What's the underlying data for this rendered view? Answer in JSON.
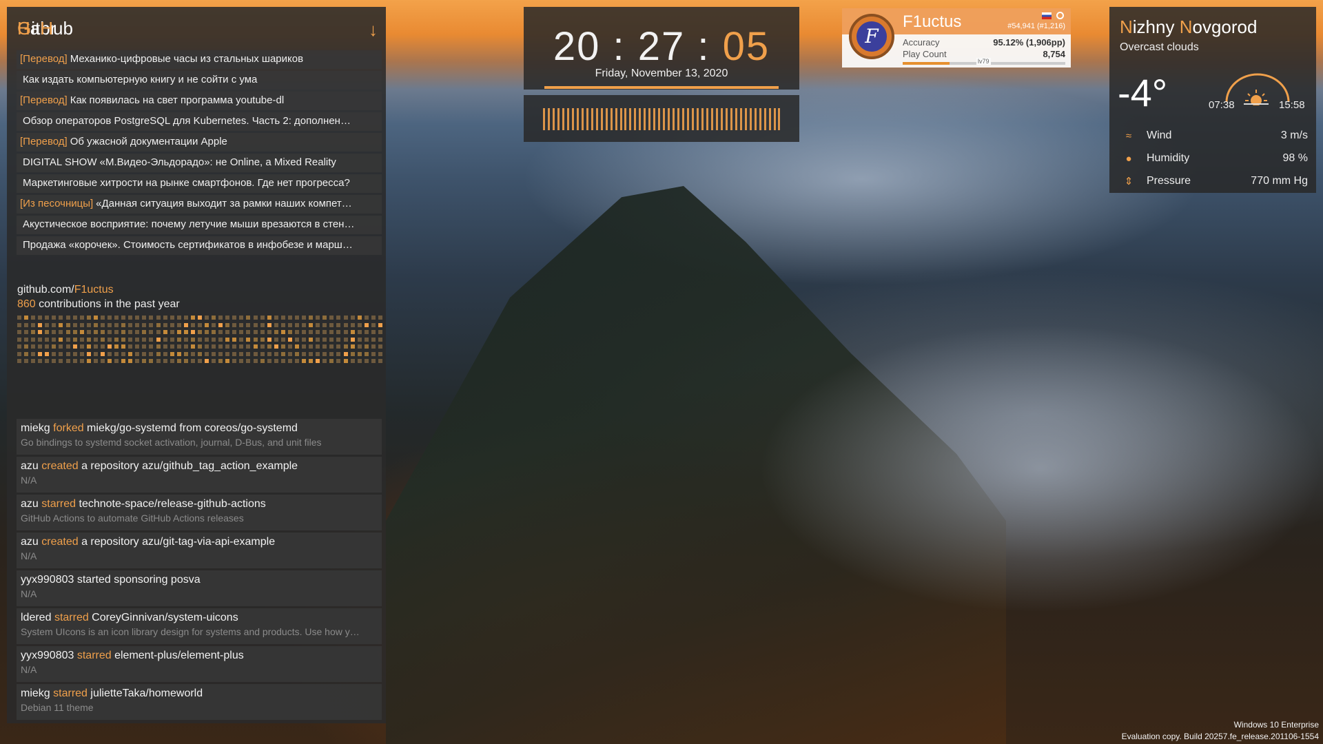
{
  "habr": {
    "title_first": "H",
    "title_rest": "abr",
    "items": [
      {
        "tag": "[Перевод]",
        "text": "Механико-цифровые часы из стальных шариков"
      },
      {
        "tag": "",
        "text": "Как издать компьютерную книгу и не сойти с ума"
      },
      {
        "tag": "[Перевод]",
        "text": "Как появилась на свет программа youtube-dl"
      },
      {
        "tag": "",
        "text": "Обзор операторов PostgreSQL для Kubernetes. Часть 2: дополнен…"
      },
      {
        "tag": "[Перевод]",
        "text": "Об ужасной документации Apple"
      },
      {
        "tag": "",
        "text": "DIGITAL SHOW «М.Видео-Эльдорадо»: не Online, a Mixed Reality"
      },
      {
        "tag": "",
        "text": "Маркетинговые хитрости на рынке смартфонов. Где нет прогресса?"
      },
      {
        "tag": "[Из песочницы]",
        "text": "«Данная ситуация выходит за рамки наших компет…"
      },
      {
        "tag": "",
        "text": "Акустическое восприятие: почему летучие мыши врезаются в стен…"
      },
      {
        "tag": "",
        "text": "Продажа «корочек». Стоимость сертификатов в инфобезе и марш…"
      }
    ]
  },
  "contrib": {
    "url_prefix": "github.com/",
    "url_user": "F1uctus",
    "count": "860",
    "suffix": " contributions in the past year"
  },
  "github": {
    "title_a": "G",
    "title_b": "it",
    "title_c": "H",
    "title_d": "ub",
    "events": [
      {
        "actor": "miekg",
        "verb": "forked",
        "rest": " miekg/go-systemd from coreos/go-systemd",
        "desc": "Go bindings to systemd socket activation, journal, D-Bus, and unit files"
      },
      {
        "actor": "azu",
        "verb": "created",
        "rest": " a repository azu/github_tag_action_example",
        "desc": "N/A"
      },
      {
        "actor": "azu",
        "verb": "starred",
        "rest": " technote-space/release-github-actions",
        "desc": "GitHub Actions to automate GitHub Actions releases"
      },
      {
        "actor": "azu",
        "verb": "created",
        "rest": " a repository azu/git-tag-via-api-example",
        "desc": "N/A"
      },
      {
        "actor": "yyx990803",
        "verb": "",
        "rest": " started sponsoring posva",
        "desc": "N/A"
      },
      {
        "actor": "ldered",
        "verb": "starred",
        "rest": " CoreyGinnivan/system-uicons",
        "desc": "System UIcons is an icon library design for systems and products. Use how y…"
      },
      {
        "actor": "yyx990803",
        "verb": "starred",
        "rest": " element-plus/element-plus",
        "desc": "N/A"
      },
      {
        "actor": "miekg",
        "verb": "starred",
        "rest": " julietteTaka/homeworld",
        "desc": "Debian 11 theme"
      }
    ]
  },
  "clock": {
    "hours": "20",
    "sep1": ":",
    "minutes": "27",
    "sep2": ":",
    "seconds": "05",
    "date": "Friday, November 13, 2020"
  },
  "osu": {
    "name": "F1uctus",
    "logo_letter": "F",
    "rank": "#54,941 (#1,216)",
    "accuracy_label": "Accuracy",
    "accuracy_value": "95.12% (1,906pp)",
    "playcount_label": "Play Count",
    "playcount_value": "8,754",
    "level": "lv79",
    "level_progress": 0.29
  },
  "weather": {
    "city_a": "N",
    "city_b": "izhny ",
    "city_c": "N",
    "city_d": "ovgorod",
    "condition": "Overcast clouds",
    "temperature": "-4°",
    "sunrise": "07:38",
    "sunset": "15:58",
    "rows": [
      {
        "icon": "wind-icon",
        "label": "Wind",
        "value": "3 m/s"
      },
      {
        "icon": "drop-icon",
        "label": "Humidity",
        "value": "98 %"
      },
      {
        "icon": "pressure-icon",
        "label": "Pressure",
        "value": "770 mm Hg"
      }
    ]
  },
  "watermark": {
    "line1": "Windows 10 Enterprise",
    "line2": "Evaluation copy. Build 20257.fe_release.201106-1554"
  },
  "colors": {
    "accent": "#f0a04b",
    "panel": "#2a2a2a"
  }
}
